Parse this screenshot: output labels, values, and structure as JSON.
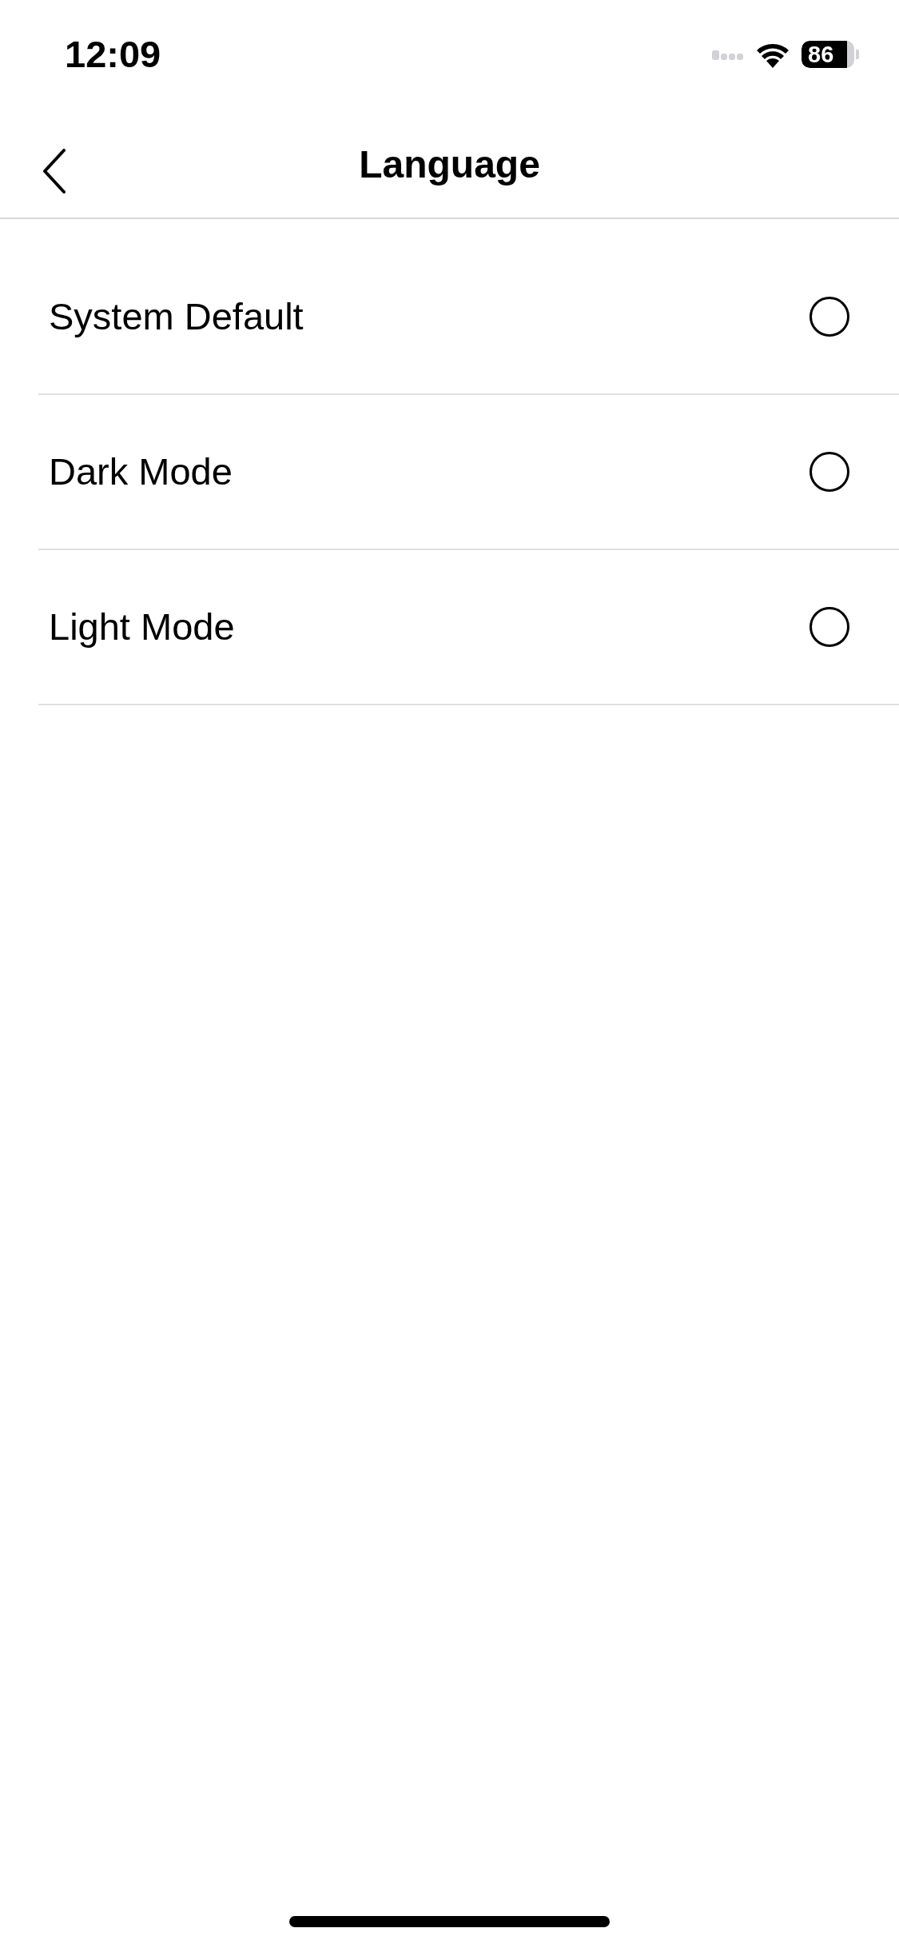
{
  "status_bar": {
    "time": "12:09",
    "battery": "86"
  },
  "header": {
    "title": "Language"
  },
  "options": [
    {
      "label": "System Default",
      "selected": false
    },
    {
      "label": "Dark Mode",
      "selected": false
    },
    {
      "label": "Light Mode",
      "selected": false
    }
  ]
}
